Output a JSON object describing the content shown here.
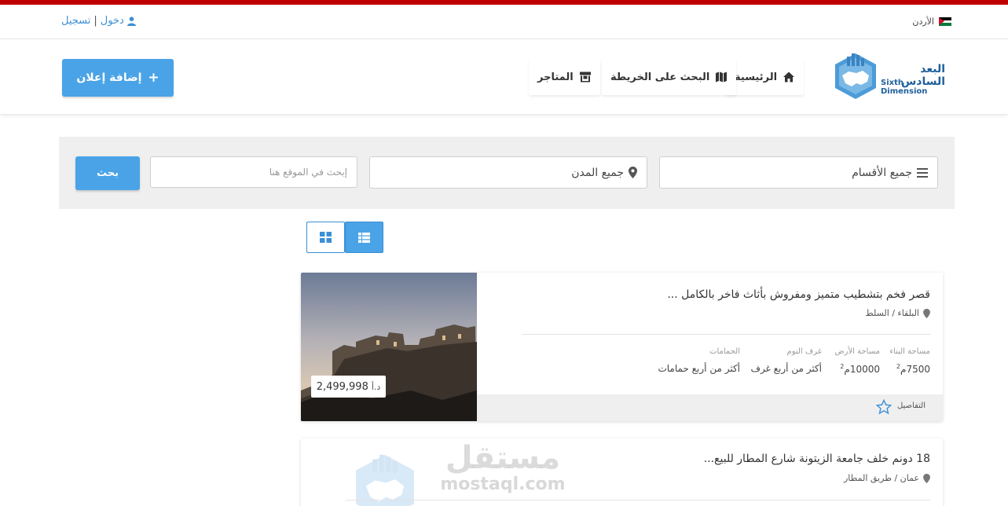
{
  "topbar": {
    "login": "دخول",
    "separator": "|",
    "register": "تسجيل",
    "country": "الأردن"
  },
  "logo": {
    "arabic": "البعد السادس",
    "english": "Sixth Dimension"
  },
  "nav": {
    "home": "الرئيسية",
    "map_search": "البحث على الخريطة",
    "stores": "المتاجر",
    "add_listing": "إضافة إعلان",
    "add_symbol": "+"
  },
  "search": {
    "categories": "جميع الأقسام",
    "cities": "جميع المدن",
    "placeholder": "إبحث في الموقع هنا",
    "button": "بحث"
  },
  "listings": [
    {
      "title": "قصر فخم بتشطيب متميز ومفروش بأثاث فاخر بالكامل ...",
      "location": "البلقاء / السلط",
      "price": "2,499,998",
      "currency": "د.أ",
      "specs": {
        "building_area_label": "مساحة البناء",
        "building_area_value": "7500",
        "land_area_label": "مساحة الأرض",
        "land_area_value": "10000",
        "area_unit": "م",
        "area_exp": "2",
        "bedrooms_label": "غرف النوم",
        "bedrooms_value": "أكثر من أربع غرف",
        "bathrooms_label": "الحمامات",
        "bathrooms_value": "أكثر من أربع حمامات"
      },
      "details": "التفاصيل"
    },
    {
      "title": "18 دونم خلف جامعة الزيتونة شارع المطار للبيع...",
      "location": "عمان / طريق المطار"
    }
  ],
  "watermark": {
    "arabic": "مستقل",
    "english": "mostaql.com"
  },
  "colors": {
    "accent": "#4aa3e6",
    "top_stripe": "#c00000",
    "logo_blue": "#1e5f9c"
  }
}
